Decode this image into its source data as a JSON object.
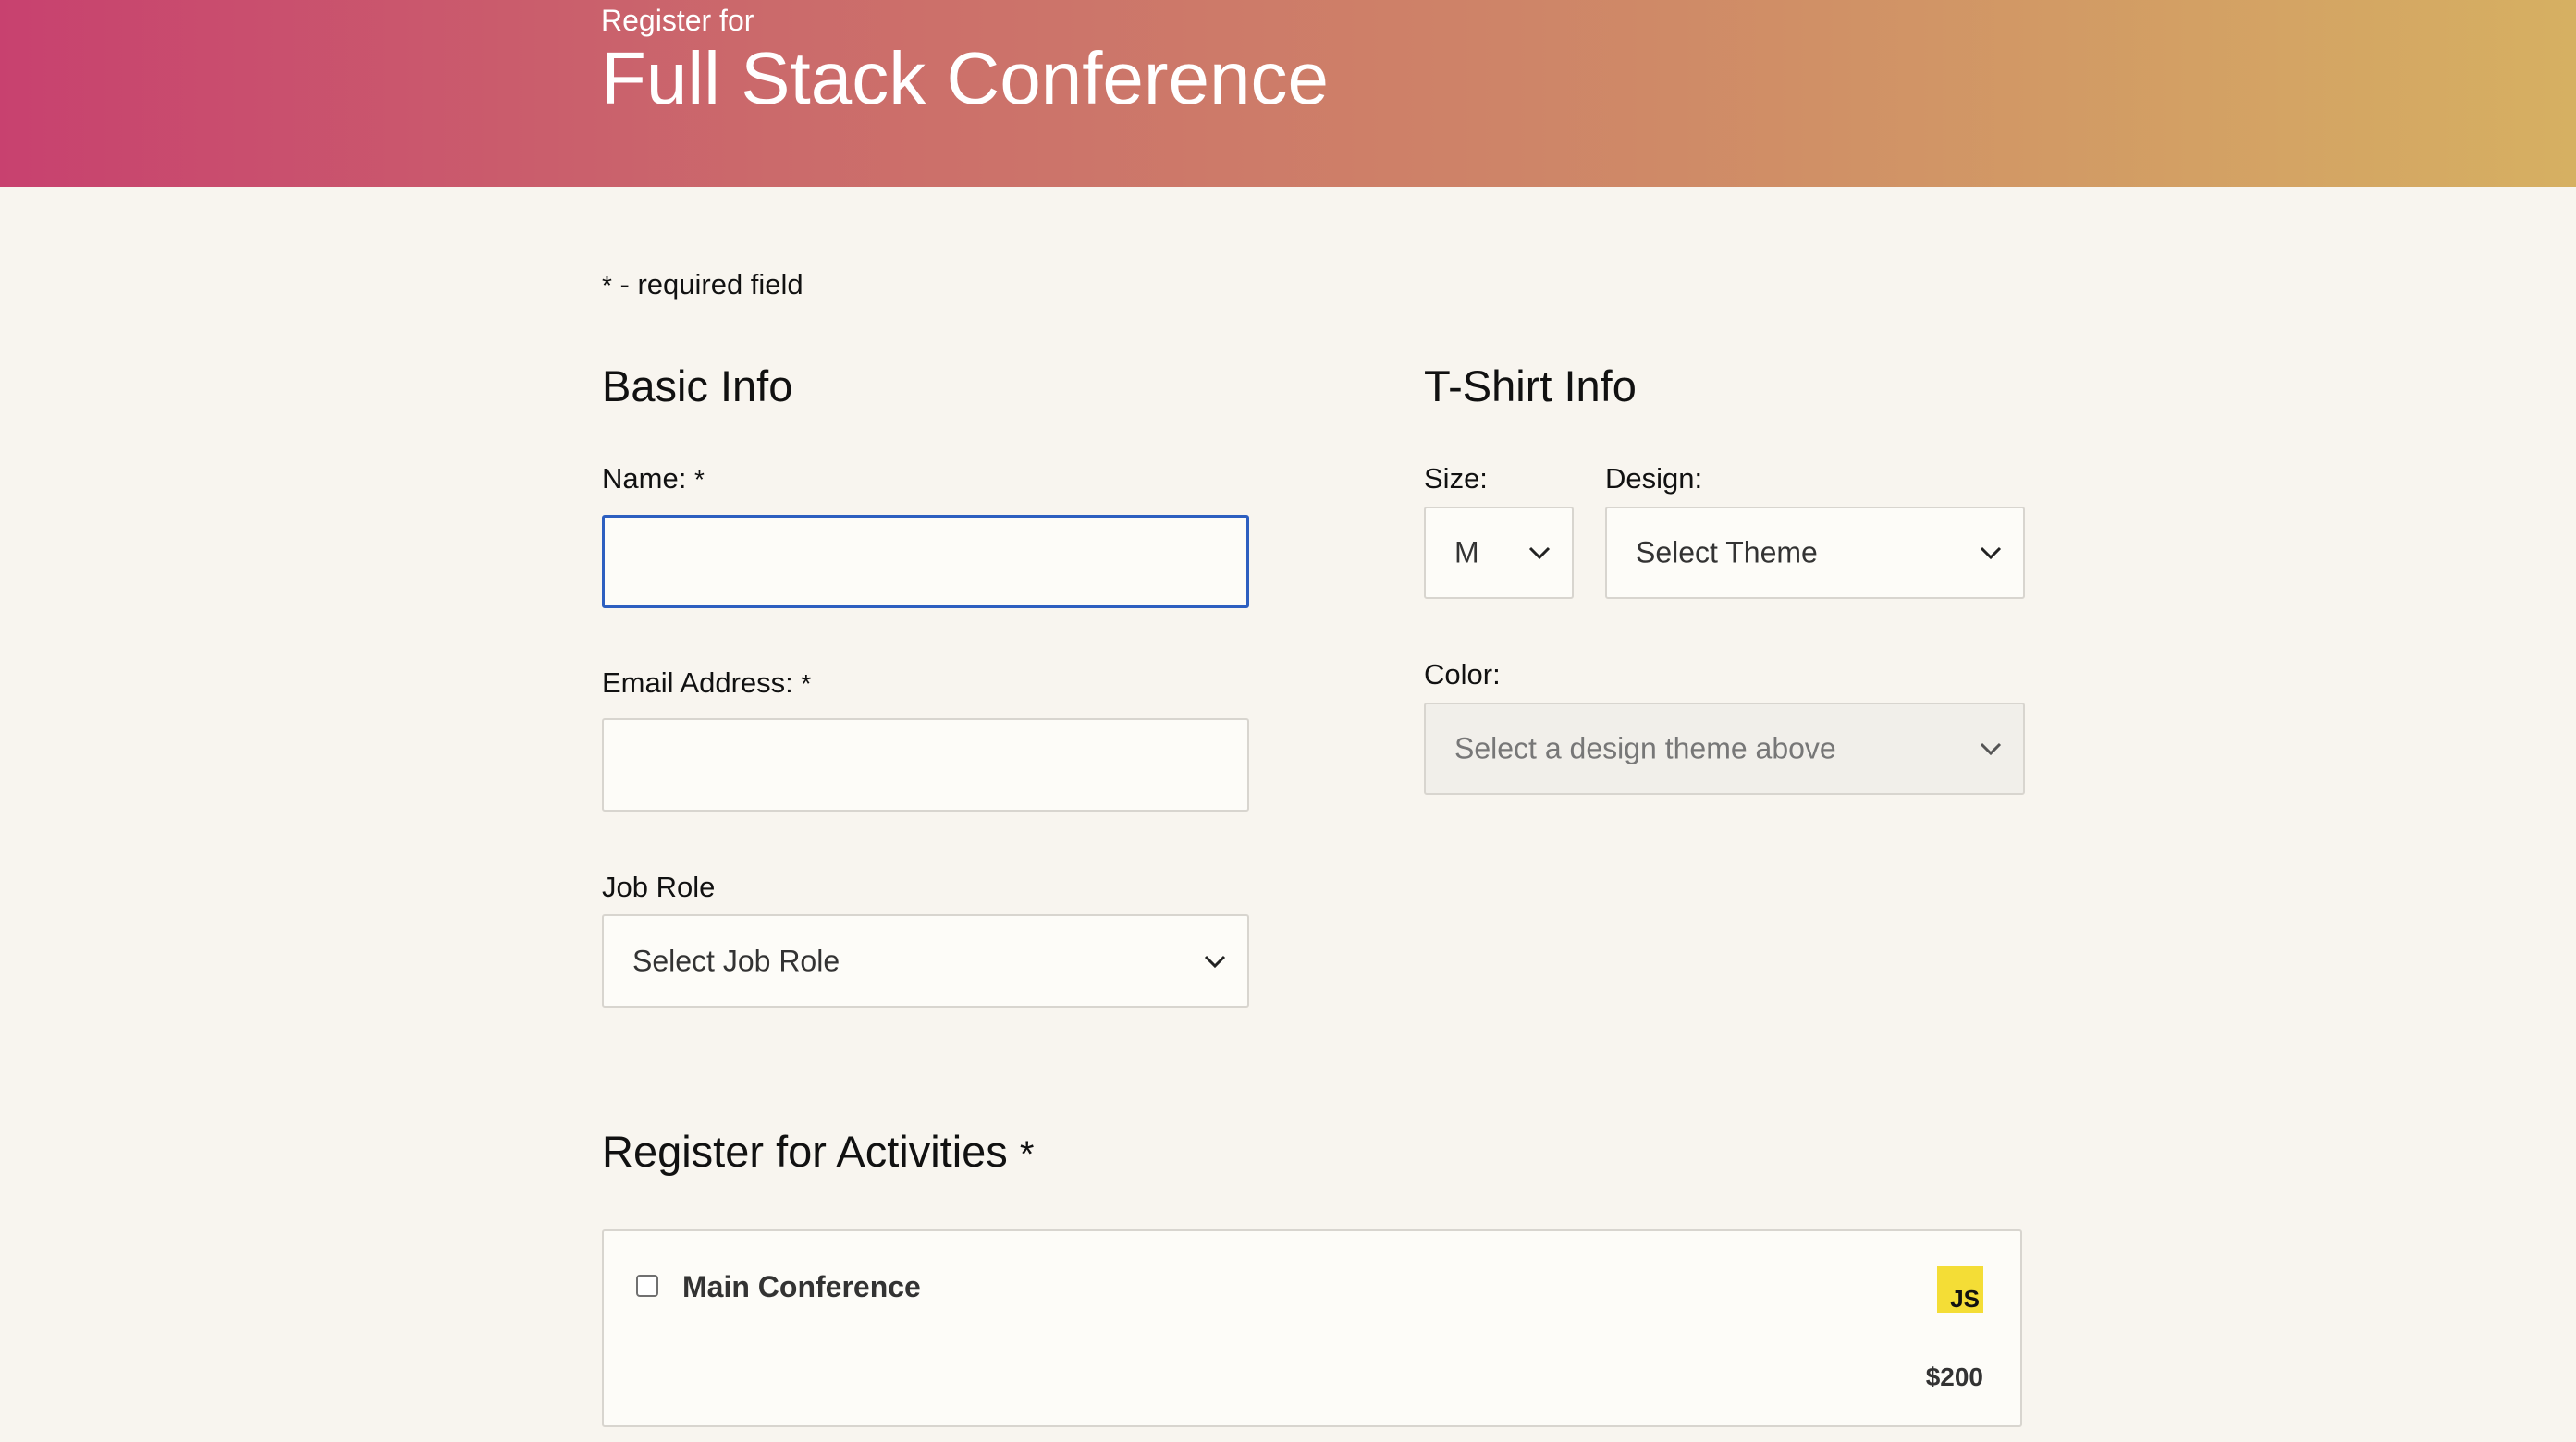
{
  "header": {
    "subtitle": "Register for",
    "title": "Full Stack Conference"
  },
  "required_note": {
    "star": "*",
    "text": " - required field"
  },
  "basic_info": {
    "title": "Basic Info",
    "name_label": "Name:",
    "name_required": "*",
    "name_value": "",
    "email_label": "Email Address:",
    "email_required": "*",
    "email_value": "",
    "job_role_label": "Job Role",
    "job_role_selected": "Select Job Role"
  },
  "tshirt_info": {
    "title": "T-Shirt Info",
    "size_label": "Size:",
    "size_selected": "M",
    "design_label": "Design:",
    "design_selected": "Select Theme",
    "color_label": "Color:",
    "color_selected": "Select a design theme above"
  },
  "activities": {
    "title": "Register for Activities",
    "required": "*",
    "items": [
      {
        "name": "Main Conference",
        "badge": "JS",
        "price": "$200",
        "checked": false
      }
    ]
  },
  "colors": {
    "header_gradient_start": "#c8416f",
    "header_gradient_end": "#d6b062",
    "page_background": "#f8f5ef",
    "focus_border": "#2d5fc0",
    "js_badge": "#f4dd36"
  }
}
